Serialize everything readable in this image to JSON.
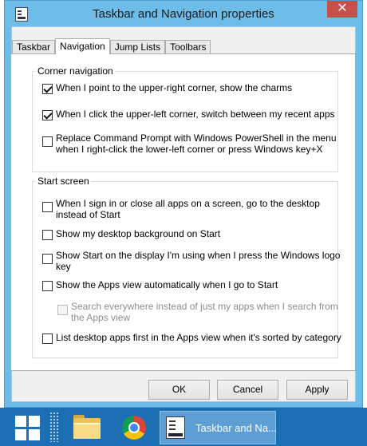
{
  "window": {
    "title": "Taskbar and Navigation properties",
    "close_glyph": "✕"
  },
  "tabs": [
    {
      "label": "Taskbar",
      "active": false
    },
    {
      "label": "Navigation",
      "active": true
    },
    {
      "label": "Jump Lists",
      "active": false
    },
    {
      "label": "Toolbars",
      "active": false
    }
  ],
  "corner_navigation": {
    "title": "Corner navigation",
    "options": [
      {
        "label": "When I point to the upper-right corner, show the charms",
        "checked": true
      },
      {
        "label": "When I click the upper-left corner, switch between my recent apps",
        "checked": true
      },
      {
        "label_line1": "Replace Command Prompt with Windows PowerShell in the menu",
        "label_line2": "when I right-click the lower-left corner or press Windows key+X",
        "checked": false
      }
    ]
  },
  "start_screen": {
    "title": "Start screen",
    "options": [
      {
        "label_line1": "When I sign in or close all apps on a screen, go to the desktop",
        "label_line2": "instead of Start",
        "checked": false
      },
      {
        "label": "Show my desktop background on Start",
        "checked": false
      },
      {
        "label_line1": "Show Start on the display I'm using when I press the Windows logo",
        "label_line2": "key",
        "checked": false
      },
      {
        "label": "Show the Apps view automatically when I go to Start",
        "checked": false
      },
      {
        "label_line1": "Search everywhere instead of just my apps when I search from",
        "label_line2": "the Apps view",
        "checked": false,
        "disabled": true
      },
      {
        "label": "List desktop apps first in the Apps view when it's sorted by category",
        "checked": false
      }
    ]
  },
  "buttons": {
    "ok": "OK",
    "cancel": "Cancel",
    "apply": "Apply"
  },
  "taskbar": {
    "active_window_label": "Taskbar and Na...",
    "icons": [
      "windows-start-icon",
      "folder-icon",
      "chrome-icon",
      "taskbar-properties-icon"
    ]
  },
  "colors": {
    "window_frame": "#6ebde8",
    "close_button": "#c7504a",
    "taskbar": "#1c6fb3"
  }
}
